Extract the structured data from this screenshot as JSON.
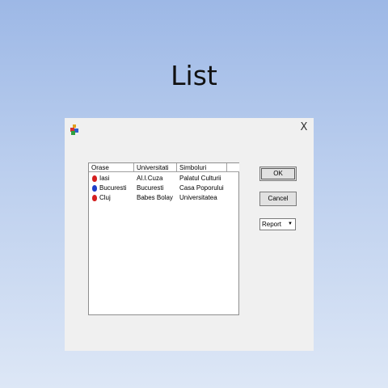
{
  "slide": {
    "title": "List"
  },
  "dialog": {
    "close_glyph": "X",
    "icon": "app-shapes-icon",
    "listview": {
      "columns": [
        "Orase",
        "Universitati",
        "Simboluri",
        ""
      ],
      "rows": [
        {
          "icon_color": "#d42020",
          "orase": "Iasi",
          "universitati": "Al.I.Cuza",
          "simboluri": "Palatul Culturii"
        },
        {
          "icon_color": "#1f3fc8",
          "orase": "Bucuresti",
          "universitati": "Bucuresti",
          "simboluri": "Casa Poporului"
        },
        {
          "icon_color": "#d42020",
          "orase": "Cluj",
          "universitati": "Babes Bolay",
          "simboluri": "Universitatea"
        }
      ]
    },
    "buttons": {
      "ok": "OK",
      "cancel": "Cancel"
    },
    "view_select": {
      "value": "Report"
    }
  }
}
